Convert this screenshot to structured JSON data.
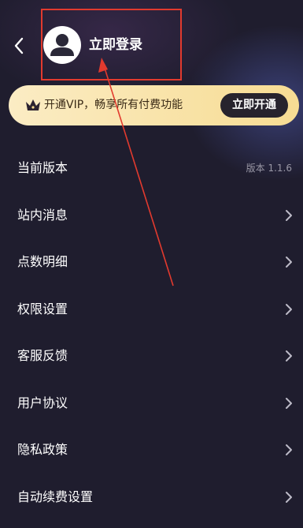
{
  "header": {
    "login_label": "立即登录",
    "back_icon": "chevron-left-icon",
    "avatar_icon": "user-avatar-icon"
  },
  "vip_banner": {
    "crown_icon": "crown-icon",
    "text": "开通VIP，畅享所有付费功能",
    "button_label": "立即开通"
  },
  "menu": {
    "items": [
      {
        "label": "当前版本",
        "value": "版本 1.1.6"
      },
      {
        "label": "站内消息"
      },
      {
        "label": "点数明细"
      },
      {
        "label": "权限设置"
      },
      {
        "label": "客服反馈"
      },
      {
        "label": "用户协议"
      },
      {
        "label": "隐私政策"
      },
      {
        "label": "自动续费设置"
      }
    ]
  },
  "colors": {
    "background": "#1f1d2e",
    "vip_gold": "#f7dc93",
    "annotation_red": "#e23a2e"
  }
}
